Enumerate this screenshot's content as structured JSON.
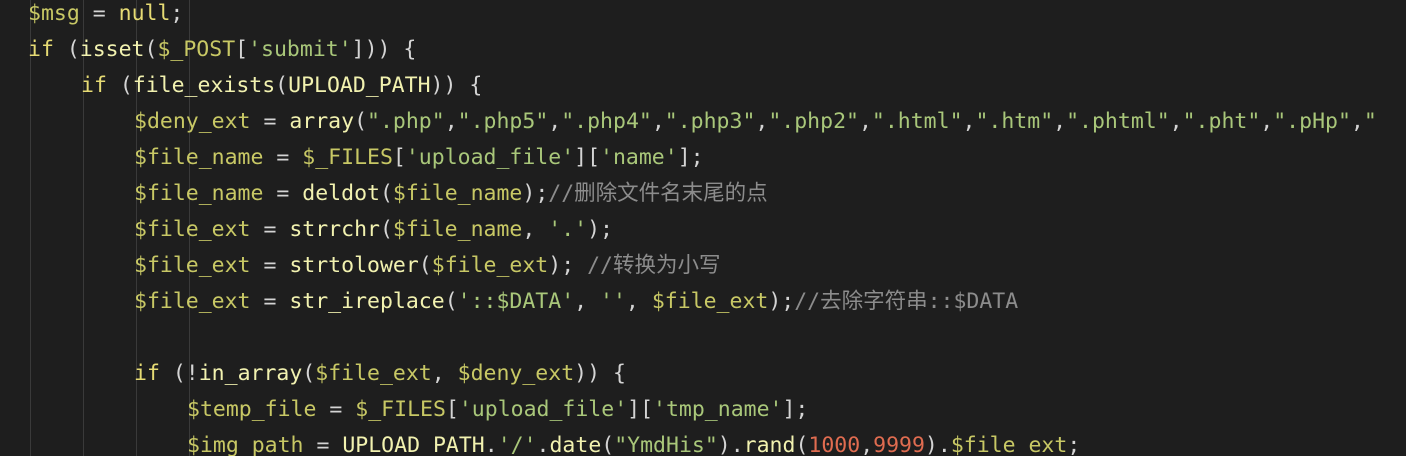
{
  "editor": {
    "language": "PHP",
    "colors": {
      "background": "#1e1e1e",
      "keyword": "#e6db74",
      "variable": "#c8c865",
      "function": "#f2f2b0",
      "string": "#a9c77a",
      "number": "#e06c50",
      "comment": "#8c8c8c",
      "punctuation": "#d4d4d4"
    },
    "lines": [
      {
        "indent": 0,
        "tokens": [
          {
            "t": "var",
            "s": "$msg"
          },
          {
            "t": "p",
            "s": " = "
          },
          {
            "t": "kw",
            "s": "null"
          },
          {
            "t": "p",
            "s": ";"
          }
        ]
      },
      {
        "indent": 0,
        "tokens": [
          {
            "t": "kw",
            "s": "if"
          },
          {
            "t": "p",
            "s": " ("
          },
          {
            "t": "fn",
            "s": "isset"
          },
          {
            "t": "p",
            "s": "("
          },
          {
            "t": "var",
            "s": "$_POST"
          },
          {
            "t": "p",
            "s": "["
          },
          {
            "t": "str",
            "s": "'submit'"
          },
          {
            "t": "p",
            "s": "])) {"
          }
        ]
      },
      {
        "indent": 1,
        "tokens": [
          {
            "t": "kw",
            "s": "if"
          },
          {
            "t": "p",
            "s": " ("
          },
          {
            "t": "fn",
            "s": "file_exists"
          },
          {
            "t": "p",
            "s": "("
          },
          {
            "t": "const",
            "s": "UPLOAD_PATH"
          },
          {
            "t": "p",
            "s": ")) {"
          }
        ]
      },
      {
        "indent": 2,
        "tokens": [
          {
            "t": "var",
            "s": "$deny_ext"
          },
          {
            "t": "p",
            "s": " = "
          },
          {
            "t": "fn",
            "s": "array"
          },
          {
            "t": "p",
            "s": "("
          },
          {
            "t": "str",
            "s": "\".php\""
          },
          {
            "t": "p",
            "s": ","
          },
          {
            "t": "str",
            "s": "\".php5\""
          },
          {
            "t": "p",
            "s": ","
          },
          {
            "t": "str",
            "s": "\".php4\""
          },
          {
            "t": "p",
            "s": ","
          },
          {
            "t": "str",
            "s": "\".php3\""
          },
          {
            "t": "p",
            "s": ","
          },
          {
            "t": "str",
            "s": "\".php2\""
          },
          {
            "t": "p",
            "s": ","
          },
          {
            "t": "str",
            "s": "\".html\""
          },
          {
            "t": "p",
            "s": ","
          },
          {
            "t": "str",
            "s": "\".htm\""
          },
          {
            "t": "p",
            "s": ","
          },
          {
            "t": "str",
            "s": "\".phtml\""
          },
          {
            "t": "p",
            "s": ","
          },
          {
            "t": "str",
            "s": "\".pht\""
          },
          {
            "t": "p",
            "s": ","
          },
          {
            "t": "str",
            "s": "\".pHp\""
          },
          {
            "t": "p",
            "s": ","
          },
          {
            "t": "str",
            "s": "\""
          }
        ]
      },
      {
        "indent": 2,
        "tokens": [
          {
            "t": "var",
            "s": "$file_name"
          },
          {
            "t": "p",
            "s": " = "
          },
          {
            "t": "var",
            "s": "$_FILES"
          },
          {
            "t": "p",
            "s": "["
          },
          {
            "t": "str",
            "s": "'upload_file'"
          },
          {
            "t": "p",
            "s": "]["
          },
          {
            "t": "str",
            "s": "'name'"
          },
          {
            "t": "p",
            "s": "];"
          }
        ]
      },
      {
        "indent": 2,
        "tokens": [
          {
            "t": "var",
            "s": "$file_name"
          },
          {
            "t": "p",
            "s": " = "
          },
          {
            "t": "fn",
            "s": "deldot"
          },
          {
            "t": "p",
            "s": "("
          },
          {
            "t": "var",
            "s": "$file_name"
          },
          {
            "t": "p",
            "s": ");"
          },
          {
            "t": "cmt",
            "s": "//删除文件名末尾的点"
          }
        ]
      },
      {
        "indent": 2,
        "tokens": [
          {
            "t": "var",
            "s": "$file_ext"
          },
          {
            "t": "p",
            "s": " = "
          },
          {
            "t": "fn",
            "s": "strrchr"
          },
          {
            "t": "p",
            "s": "("
          },
          {
            "t": "var",
            "s": "$file_name"
          },
          {
            "t": "p",
            "s": ", "
          },
          {
            "t": "str",
            "s": "'.'"
          },
          {
            "t": "p",
            "s": ");"
          }
        ]
      },
      {
        "indent": 2,
        "tokens": [
          {
            "t": "var",
            "s": "$file_ext"
          },
          {
            "t": "p",
            "s": " = "
          },
          {
            "t": "fn",
            "s": "strtolower"
          },
          {
            "t": "p",
            "s": "("
          },
          {
            "t": "var",
            "s": "$file_ext"
          },
          {
            "t": "p",
            "s": "); "
          },
          {
            "t": "cmt",
            "s": "//转换为小写"
          }
        ]
      },
      {
        "indent": 2,
        "tokens": [
          {
            "t": "var",
            "s": "$file_ext"
          },
          {
            "t": "p",
            "s": " = "
          },
          {
            "t": "fn",
            "s": "str_ireplace"
          },
          {
            "t": "p",
            "s": "("
          },
          {
            "t": "str",
            "s": "'::$DATA'"
          },
          {
            "t": "p",
            "s": ", "
          },
          {
            "t": "str",
            "s": "''"
          },
          {
            "t": "p",
            "s": ", "
          },
          {
            "t": "var",
            "s": "$file_ext"
          },
          {
            "t": "p",
            "s": ");"
          },
          {
            "t": "cmt",
            "s": "//去除字符串::$DATA"
          }
        ]
      },
      {
        "indent": 0,
        "tokens": []
      },
      {
        "indent": 2,
        "tokens": [
          {
            "t": "kw",
            "s": "if"
          },
          {
            "t": "p",
            "s": " (!"
          },
          {
            "t": "fn",
            "s": "in_array"
          },
          {
            "t": "p",
            "s": "("
          },
          {
            "t": "var",
            "s": "$file_ext"
          },
          {
            "t": "p",
            "s": ", "
          },
          {
            "t": "var",
            "s": "$deny_ext"
          },
          {
            "t": "p",
            "s": ")) {"
          }
        ]
      },
      {
        "indent": 3,
        "tokens": [
          {
            "t": "var",
            "s": "$temp_file"
          },
          {
            "t": "p",
            "s": " = "
          },
          {
            "t": "var",
            "s": "$_FILES"
          },
          {
            "t": "p",
            "s": "["
          },
          {
            "t": "str",
            "s": "'upload_file'"
          },
          {
            "t": "p",
            "s": "]["
          },
          {
            "t": "str",
            "s": "'tmp_name'"
          },
          {
            "t": "p",
            "s": "];"
          }
        ]
      },
      {
        "indent": 3,
        "tokens": [
          {
            "t": "var",
            "s": "$img_path"
          },
          {
            "t": "p",
            "s": " = "
          },
          {
            "t": "const",
            "s": "UPLOAD_PATH"
          },
          {
            "t": "p",
            "s": "."
          },
          {
            "t": "str",
            "s": "'/'"
          },
          {
            "t": "p",
            "s": "."
          },
          {
            "t": "fn",
            "s": "date"
          },
          {
            "t": "p",
            "s": "("
          },
          {
            "t": "str",
            "s": "\"YmdHis\""
          },
          {
            "t": "p",
            "s": ")."
          },
          {
            "t": "fn",
            "s": "rand"
          },
          {
            "t": "p",
            "s": "("
          },
          {
            "t": "num",
            "s": "1000"
          },
          {
            "t": "p",
            "s": ","
          },
          {
            "t": "num",
            "s": "9999"
          },
          {
            "t": "p",
            "s": ")."
          },
          {
            "t": "var",
            "s": "$file_ext"
          },
          {
            "t": "p",
            "s": ";"
          }
        ]
      }
    ]
  }
}
